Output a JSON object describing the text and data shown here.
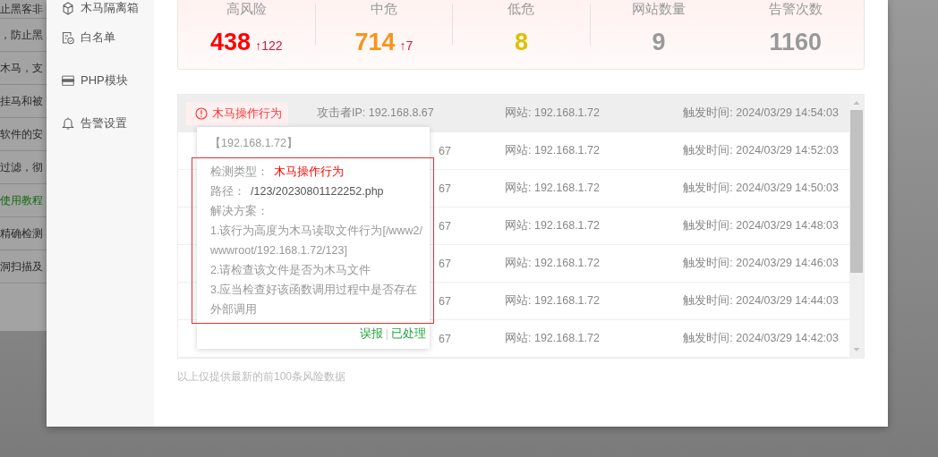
{
  "background_page": {
    "rows": [
      {
        "text": "止黑客非",
        "kind": "text"
      },
      {
        "text": "，防止黑",
        "kind": "text"
      },
      {
        "text": "木马，支",
        "kind": "text"
      },
      {
        "text": "挂马和被",
        "kind": "text"
      },
      {
        "text": "软件的安",
        "kind": "text"
      },
      {
        "text": "过滤，彻",
        "kind": "text"
      },
      {
        "text": "使用教程",
        "kind": "link"
      },
      {
        "text": "精确检测",
        "kind": "text"
      },
      {
        "text": "洞扫描及",
        "kind": "text"
      }
    ]
  },
  "sidebar": {
    "items": [
      {
        "label": "木马隔离箱",
        "kind": "box"
      },
      {
        "label": "白名单",
        "kind": "whitelist"
      },
      {
        "label": "PHP模块",
        "kind": "php"
      },
      {
        "label": "告警设置",
        "kind": "bell"
      }
    ]
  },
  "stats": [
    {
      "label": "高风险",
      "value": "438",
      "delta": "↑122",
      "color": "#ff0000"
    },
    {
      "label": "中危",
      "value": "714",
      "delta": "↑7",
      "color": "#f7941d"
    },
    {
      "label": "低危",
      "value": "8",
      "color": "#dfc000"
    },
    {
      "label": "网站数量",
      "value": "9",
      "color": "#999999"
    },
    {
      "label": "告警次数",
      "value": "1160",
      "color": "#999999"
    }
  ],
  "alerts": {
    "rows": [
      {
        "tag": "木马操作行为",
        "attacker": "攻击者IP: 192.168.8.67",
        "site": "网站: 192.168.1.72",
        "time": "触发时间: 2024/03/29 14:54:03",
        "selected": true
      },
      {
        "attacker": "67",
        "site": "网站: 192.168.1.72",
        "time": "触发时间: 2024/03/29 14:52:03",
        "selected": false
      },
      {
        "attacker": "67",
        "site": "网站: 192.168.1.72",
        "time": "触发时间: 2024/03/29 14:50:03",
        "selected": false
      },
      {
        "attacker": "67",
        "site": "网站: 192.168.1.72",
        "time": "触发时间: 2024/03/29 14:48:03",
        "selected": false
      },
      {
        "attacker": "67",
        "site": "网站: 192.168.1.72",
        "time": "触发时间: 2024/03/29 14:46:03",
        "selected": false
      },
      {
        "attacker": "67",
        "site": "网站: 192.168.1.72",
        "time": "触发时间: 2024/03/29 14:44:03",
        "selected": false
      },
      {
        "attacker": "67",
        "site": "网站: 192.168.1.72",
        "time": "触发时间: 2024/03/29 14:42:03",
        "selected": false
      }
    ],
    "note": "以上仅提供最新的前100条风险数据"
  },
  "popover": {
    "title": "【192.168.1.72】",
    "type_label": "检测类型：",
    "type_value": "木马操作行为",
    "path_label": "路径：",
    "path_value": "/123/20230801122252.php",
    "solution_label": "解决方案：",
    "steps": [
      "1.该行为高度为木马读取文件行为[/www2/wwwroot/192.168.1.72/123]",
      "2.请检查该文件是否为木马文件",
      "3.应当检查好该函数调用过程中是否存在外部调用"
    ],
    "actions": [
      "误报",
      "已处理"
    ],
    "separator": "|"
  }
}
